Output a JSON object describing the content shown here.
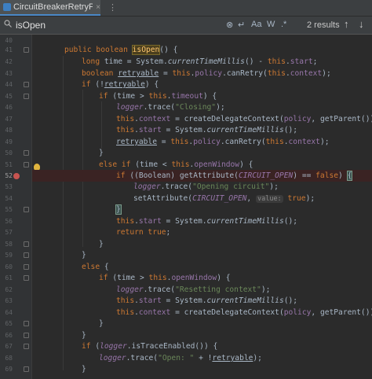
{
  "tab": {
    "label": "CircuitBreakerRetryPolicy.java",
    "close": "×",
    "more": "⋮"
  },
  "find": {
    "query": "isOpen",
    "results": "2 results",
    "up": "↑",
    "down": "↓",
    "case": "Aa",
    "word": "W",
    "regex": ".*"
  },
  "lines": [
    {
      "n": "40",
      "t": ""
    },
    {
      "n": "41",
      "t": "public boolean isOpen() {"
    },
    {
      "n": "42",
      "t": "long time = System.currentTimeMillis() - this.start;"
    },
    {
      "n": "43",
      "t": "boolean retryable = this.policy.canRetry(this.context);"
    },
    {
      "n": "44",
      "t": "if (!retryable) {"
    },
    {
      "n": "45",
      "t": "if (time > this.timeout) {"
    },
    {
      "n": "46",
      "t": "logger.trace(\"Closing\");"
    },
    {
      "n": "47",
      "t": "this.context = createDelegateContext(policy, getParent());"
    },
    {
      "n": "48",
      "t": "this.start = System.currentTimeMillis();"
    },
    {
      "n": "49",
      "t": "retryable = this.policy.canRetry(this.context);"
    },
    {
      "n": "50",
      "t": "}"
    },
    {
      "n": "51",
      "t": "else if (time < this.openWindow) {"
    },
    {
      "n": "52",
      "t": "if ((Boolean) getAttribute(CIRCUIT_OPEN) == false) {"
    },
    {
      "n": "53",
      "t": "logger.trace(\"Opening circuit\");"
    },
    {
      "n": "54",
      "t": "setAttribute(CIRCUIT_OPEN, value: true);"
    },
    {
      "n": "55",
      "t": "}"
    },
    {
      "n": "56",
      "t": "this.start = System.currentTimeMillis();"
    },
    {
      "n": "57",
      "t": "return true;"
    },
    {
      "n": "58",
      "t": "}"
    },
    {
      "n": "59",
      "t": "}"
    },
    {
      "n": "60",
      "t": "else {"
    },
    {
      "n": "61",
      "t": "if (time > this.openWindow) {"
    },
    {
      "n": "62",
      "t": "logger.trace(\"Resetting context\");"
    },
    {
      "n": "63",
      "t": "this.start = System.currentTimeMillis();"
    },
    {
      "n": "64",
      "t": "this.context = createDelegateContext(policy, getParent());"
    },
    {
      "n": "65",
      "t": "}"
    },
    {
      "n": "66",
      "t": "}"
    },
    {
      "n": "67",
      "t": "if (logger.isTraceEnabled()) {"
    },
    {
      "n": "68",
      "t": "logger.trace(\"Open: \" + !retryable);"
    },
    {
      "n": "69",
      "t": "}"
    }
  ],
  "colors": {
    "bg": "#2b2b2b",
    "keyword": "#cc7832",
    "method": "#ffc66d",
    "field": "#9876aa",
    "string": "#6a8759",
    "breakpoint": "#c75450"
  }
}
